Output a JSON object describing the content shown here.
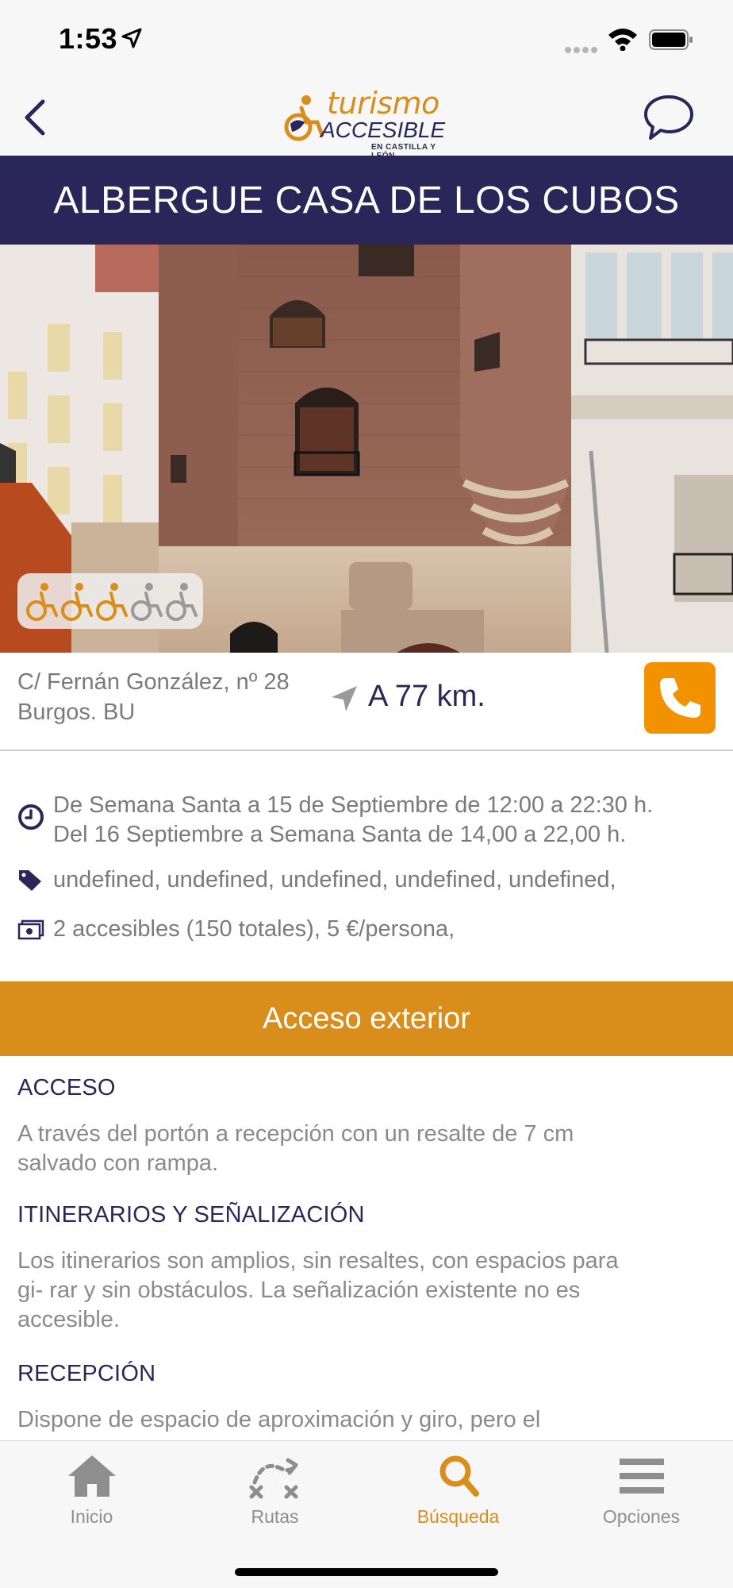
{
  "status_bar": {
    "time": "1:53"
  },
  "header": {
    "logo_word1": "turismo",
    "logo_word2": "ACCESIBLE",
    "logo_word3": "EN CASTILLA Y LEÓN"
  },
  "title": "ALBERGUE CASA DE LOS CUBOS",
  "rating": {
    "value": 3,
    "max": 5
  },
  "info": {
    "address_line1": "C/ Fernán González, nº 28",
    "address_line2": "Burgos. BU",
    "distance": "A 77 km."
  },
  "details": {
    "schedule_line1": "De Semana Santa a 15 de Septiembre de 12:00 a 22:30 h.",
    "schedule_line2": "Del 16 Septiembre a Semana Santa de 14,00 a 22,00 h.",
    "tags": "undefined, undefined, undefined, undefined, undefined,",
    "price": "2 accesibles (150 totales), 5 €/persona,"
  },
  "section": {
    "title": "Acceso exterior",
    "items": [
      {
        "heading": "ACCESO",
        "text_lines": [
          "A través del portón a recepción con un resalte de 7 cm",
          "salvado con rampa."
        ]
      },
      {
        "heading": "ITINERARIOS Y SEÑALIZACIÓN",
        "text_lines": [
          "Los itinerarios son amplios, sin resaltes, con espacios para",
          "gi- rar y sin obstáculos. La señalización existente no es",
          "accesible."
        ]
      },
      {
        "heading": "RECEPCIÓN",
        "text_lines": [
          "Dispone de espacio de aproximación y giro, pero el"
        ]
      }
    ]
  },
  "tabs": [
    {
      "label": "Inicio",
      "icon": "home-icon",
      "active": false
    },
    {
      "label": "Rutas",
      "icon": "routes-icon",
      "active": false
    },
    {
      "label": "Búsqueda",
      "icon": "search-icon",
      "active": true
    },
    {
      "label": "Opciones",
      "icon": "menu-icon",
      "active": false
    }
  ],
  "colors": {
    "brand_navy": "#2b2659",
    "brand_orange": "#d98d1a",
    "call_orange": "#f39200"
  }
}
